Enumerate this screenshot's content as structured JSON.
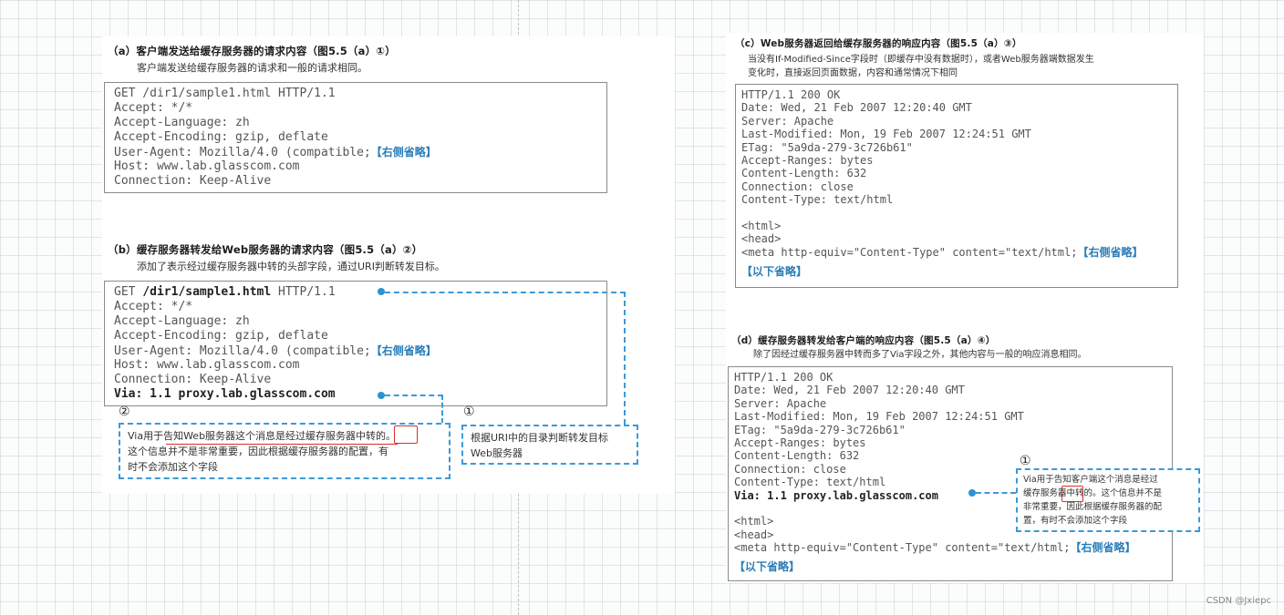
{
  "left": {
    "a": {
      "title": "（a）客户端发送给缓存服务器的请求内容（图5.5（a）①）",
      "subtitle": "客户端发送给缓存服务器的请求和一般的请求相同。",
      "lines": [
        "GET /dir1/sample1.html HTTP/1.1",
        "Accept: */*",
        "Accept-Language: zh",
        "Accept-Encoding: gzip, deflate",
        "User-Agent: Mozilla/4.0 (compatible;",
        "Host: www.lab.glasscom.com",
        "Connection: Keep-Alive"
      ],
      "omit_right": "【右侧省略】"
    },
    "b": {
      "title": "（b）缓存服务器转发给Web服务器的请求内容（图5.5（a）②）",
      "subtitle": "添加了表示经过缓存服务器中转的头部字段，通过URI判断转发目标。",
      "get_prefix": "GET ",
      "get_path": "/dir1/sample1.html",
      "get_suffix": " HTTP/1.1",
      "lines": [
        "Accept: */*",
        "Accept-Language: zh",
        "Accept-Encoding: gzip, deflate",
        "User-Agent: Mozilla/4.0 (compatible;",
        "Host: www.lab.glasscom.com",
        "Connection: Keep-Alive"
      ],
      "omit_right": "【右侧省略】",
      "via": "Via: 1.1 proxy.lab.glasscom.com",
      "note2_num": "②",
      "note2_lines": [
        "Via用于告知Web服务器这个消息是经过缓存服务器中转的。",
        "这个信息并不是非常重要，因此根据缓存服务器的配置，有",
        "时不会添加这个字段"
      ],
      "note1_num": "①",
      "note1_lines": [
        "根据URI中的目录判断转发目标",
        "Web服务器"
      ]
    }
  },
  "right": {
    "c": {
      "title": "（c）Web服务器返回给缓存服务器的响应内容（图5.5（a）③）",
      "subtitle_lines": [
        "当没有If-Modified-Since字段时（即缓存中没有数据时），或者Web服务器端数据发生",
        "变化时，直接返回页面数据，内容和通常情况下相同"
      ],
      "lines": [
        "HTTP/1.1 200 OK",
        "Date: Wed, 21 Feb 2007 12:20:40 GMT",
        "Server: Apache",
        "Last-Modified: Mon, 19 Feb 2007 12:24:51 GMT",
        "ETag: \"5a9da-279-3c726b61\"",
        "Accept-Ranges: bytes",
        "Content-Length: 632",
        "Connection: close",
        "Content-Type: text/html"
      ],
      "html_lines": [
        "<html>",
        "<head>",
        "<meta http-equiv=\"Content-Type\" content=\"text/html;"
      ],
      "omit_right": "【右侧省略】",
      "omit_below": "【以下省略】"
    },
    "d": {
      "title": "（d）缓存服务器转发给客户端的响应内容（图5.5（a）④）",
      "subtitle": "除了因经过缓存服务器中转而多了Via字段之外，其他内容与一般的响应消息相同。",
      "lines": [
        "HTTP/1.1 200 OK",
        "Date: Wed, 21 Feb 2007 12:20:40 GMT",
        "Server: Apache",
        "Last-Modified: Mon, 19 Feb 2007 12:24:51 GMT",
        "ETag: \"5a9da-279-3c726b61\"",
        "Accept-Ranges: bytes",
        "Content-Length: 632",
        "Connection: close",
        "Content-Type: text/html"
      ],
      "via": "Via: 1.1 proxy.lab.glasscom.com",
      "html_lines": [
        "<html>",
        "<head>",
        "<meta http-equiv=\"Content-Type\" content=\"text/html;"
      ],
      "omit_right": "【右侧省略】",
      "omit_below": "【以下省略】",
      "note_num": "①",
      "note_lines": [
        "Via用于告知客户端这个消息是经过",
        "缓存服务器中转的。这个信息并不是",
        "非常重要，因此根据缓存服务器的配",
        "置，有时不会添加这个字段"
      ]
    }
  },
  "watermark": "CSDN @Jxiepc"
}
